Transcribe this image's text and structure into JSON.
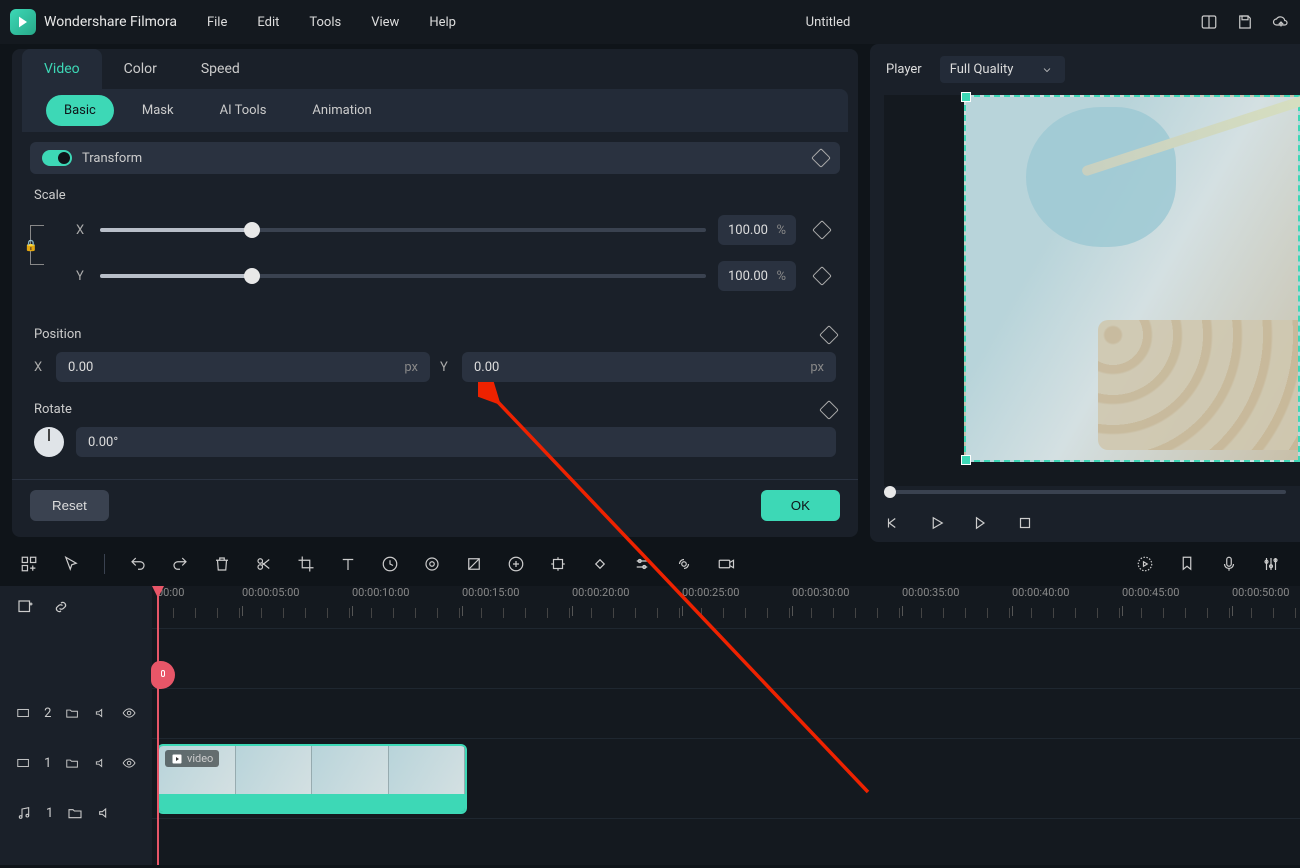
{
  "app": {
    "name": "Wondershare Filmora",
    "doc_title": "Untitled"
  },
  "menu": [
    "File",
    "Edit",
    "Tools",
    "View",
    "Help"
  ],
  "main_tabs": [
    "Video",
    "Color",
    "Speed"
  ],
  "sub_tabs": [
    "Basic",
    "Mask",
    "AI Tools",
    "Animation"
  ],
  "transform": {
    "title": "Transform",
    "scale_label": "Scale",
    "scale_x": {
      "axis": "X",
      "value": "100.00",
      "unit": "%"
    },
    "scale_y": {
      "axis": "Y",
      "value": "100.00",
      "unit": "%"
    },
    "position_label": "Position",
    "pos_x": {
      "axis": "X",
      "value": "0.00",
      "unit": "px"
    },
    "pos_y": {
      "axis": "Y",
      "value": "0.00",
      "unit": "px"
    },
    "rotate_label": "Rotate",
    "rotate_value": "0.00°"
  },
  "buttons": {
    "reset": "Reset",
    "ok": "OK"
  },
  "player": {
    "title": "Player",
    "quality": "Full Quality"
  },
  "timeline": {
    "ticks": [
      "00:00",
      "00:00:05:00",
      "00:00:10:00",
      "00:00:15:00",
      "00:00:20:00",
      "00:00:25:00",
      "00:00:30:00",
      "00:00:35:00",
      "00:00:40:00",
      "00:00:45:00",
      "00:00:50:00"
    ],
    "clip_name": "video",
    "track2_label": "2",
    "track1_label": "1",
    "audio1_label": "1"
  }
}
